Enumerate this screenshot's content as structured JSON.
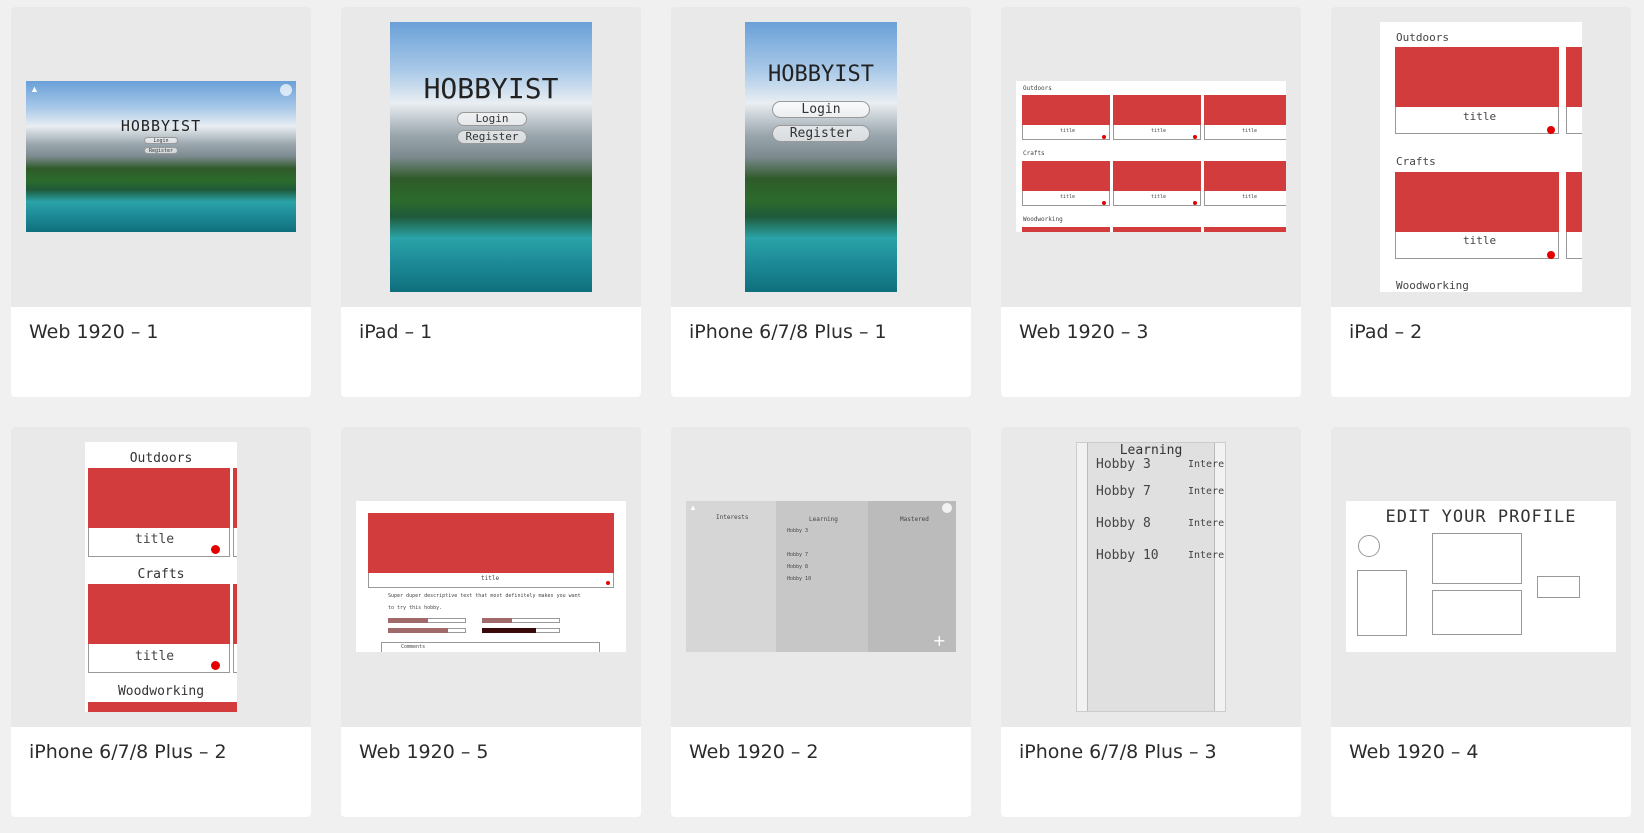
{
  "cards": [
    {
      "label": "Web 1920 – 1"
    },
    {
      "label": "iPad – 1"
    },
    {
      "label": "iPhone 6/7/8 Plus – 1"
    },
    {
      "label": "Web 1920 – 3"
    },
    {
      "label": "iPad – 2"
    },
    {
      "label": "iPhone 6/7/8 Plus – 2"
    },
    {
      "label": "Web 1920 – 5"
    },
    {
      "label": "Web 1920 – 2"
    },
    {
      "label": "iPhone 6/7/8 Plus – 3"
    },
    {
      "label": "Web 1920 – 4"
    }
  ],
  "thumbs": {
    "hobbyist_title": "HOBBYIST",
    "login": "Login",
    "register": "Register",
    "outdoors": "Outdoors",
    "crafts": "Crafts",
    "woodworking": "Woodworking",
    "title": "title",
    "web5_desc1": "Super duper descriptive text that most definitely makes you want",
    "web5_desc2": "to try this hobby.",
    "web5_comments": "Comments",
    "learning": "Learning",
    "interests_col": "Interests",
    "mastered_col": "Mastered",
    "hobby3": "Hobby 3",
    "hobby7": "Hobby 7",
    "hobby8": "Hobby 8",
    "hobby10": "Hobby 10",
    "interests_trunc": "Intere",
    "edit_profile": "EDIT YOUR PROFILE",
    "plus": "+"
  },
  "colors": {
    "accent_red": "#d23c3c",
    "dot_red": "#e30000"
  }
}
